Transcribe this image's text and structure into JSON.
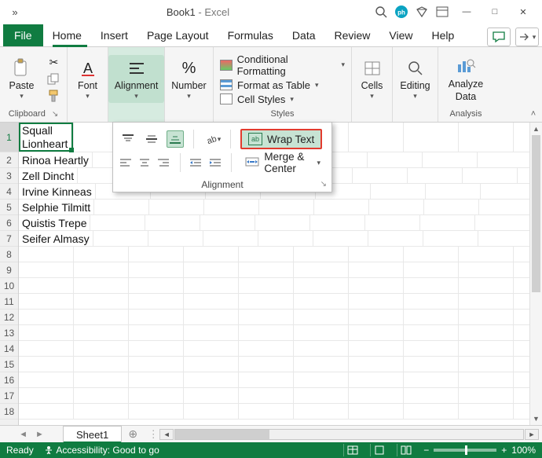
{
  "title": {
    "doc": "Book1",
    "app": "Excel",
    "sep": " - "
  },
  "tabs": {
    "file": "File",
    "home": "Home",
    "insert": "Insert",
    "page_layout": "Page Layout",
    "formulas": "Formulas",
    "data": "Data",
    "review": "Review",
    "view": "View",
    "help": "Help"
  },
  "ribbon": {
    "clipboard": {
      "paste": "Paste",
      "label": "Clipboard"
    },
    "font": {
      "label": "Font"
    },
    "alignment": {
      "label": "Alignment"
    },
    "number": {
      "label": "Number"
    },
    "styles": {
      "cond": "Conditional Formatting",
      "table": "Format as Table",
      "cell": "Cell Styles",
      "label": "Styles"
    },
    "cells": {
      "label": "Cells"
    },
    "editing": {
      "label": "Editing"
    },
    "analysis": {
      "btn_l1": "Analyze",
      "btn_l2": "Data",
      "label": "Analysis"
    }
  },
  "panel": {
    "wrap": "Wrap Text",
    "merge": "Merge & Center",
    "label": "Alignment"
  },
  "cells": {
    "a1": "Squall Lionheart",
    "a2": "Rinoa Heartly",
    "a3": "Zell Dincht",
    "a4": "Irvine Kinneas",
    "a5": "Selphie Tilmitt",
    "a6": "Quistis Trepe",
    "a7": "Seifer Almasy"
  },
  "rows": [
    "1",
    "2",
    "3",
    "4",
    "5",
    "6",
    "7",
    "8",
    "9",
    "10",
    "11",
    "12",
    "13",
    "14",
    "15",
    "16",
    "17",
    "18"
  ],
  "sheet": {
    "name": "Sheet1"
  },
  "status": {
    "ready": "Ready",
    "acc": "Accessibility: Good to go",
    "zoom": "100%"
  }
}
